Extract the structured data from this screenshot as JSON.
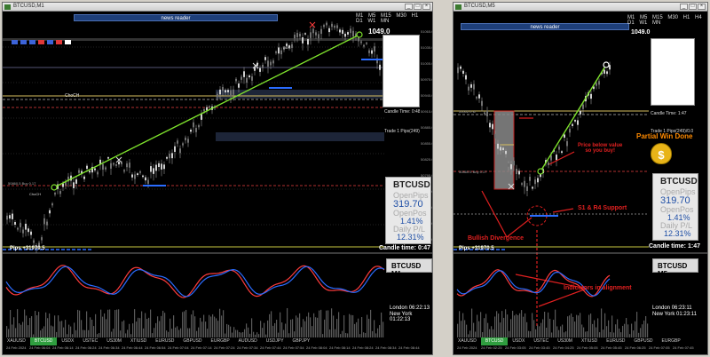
{
  "left": {
    "title": "BTCUSD,M1",
    "newsbar": "news reader",
    "timeframes": "M1 M5 M15 M30 H1 H4 D1 W1 MN",
    "price_tag": "1049.0",
    "symbol": "BTCUSD",
    "open_pips_label": "OpenPips",
    "open_pips_value": "319.70",
    "open_pos_label": "OpenPos",
    "open_pos_value": "1.41%",
    "daily_pl_label": "Daily P/L",
    "daily_pl_value": "12.31%",
    "candle_time_label": "Candle time:",
    "candle_time_value": "0:47",
    "pips_text": "Pips +31970.5",
    "indicator_title": "BTCUSD M1",
    "london_label": "London",
    "london_time": "06:22:13",
    "newyork_label": "New York",
    "newyork_time": "01:22:13",
    "trade_label": "Trade 1 Pips(249)/1.0",
    "candle_time_small": "Candle Time: 0:48",
    "tabs": [
      "XAUUSD",
      "BTCUSD",
      "USDX",
      "USTEC",
      "US30M",
      "XTIUSD",
      "EURUSD",
      "GBPUSD",
      "EURGBP",
      "AUDUSD",
      "USDJPY",
      "GBPJPY"
    ],
    "active_tab": "BTCUSD",
    "dates": [
      "24 Feb 2024",
      "24 Feb 06:04",
      "24 Feb 06:14",
      "24 Feb 06:24",
      "24 Feb 06:34",
      "24 Feb 06:44",
      "24 Feb 06:54",
      "24 Feb 07:04",
      "24 Feb 07:14",
      "24 Feb 07:24",
      "24 Feb 07:34",
      "24 Feb 07:44",
      "24 Feb 07:54",
      "24 Feb 08:04",
      "24 Feb 08:14",
      "24 Feb 08:24",
      "24 Feb 08:34",
      "24 Feb 08:44"
    ],
    "price_axis": [
      "51065.00",
      "51035.00",
      "51005.00",
      "50975.00",
      "50945.00",
      "50915.00",
      "50885.00",
      "50855.00",
      "50825.00",
      "50795.00",
      "50765.00",
      "50735.00",
      "50705.00",
      "50675.00"
    ],
    "chch_label": "ChoCH",
    "bos_label": "BOS",
    "level_label": "50860.5 Buy 0.17"
  },
  "right": {
    "title": "BTCUSD,M5",
    "newsbar": "news reader",
    "timeframes": "M1 M5 M15 M30 H1 H4 D1 W1 MN",
    "price_tag": "1049.0",
    "symbol": "BTCUSD",
    "open_pips_label": "OpenPips",
    "open_pips_value": "319.70",
    "open_pos_label": "OpenPos",
    "open_pos_value": "1.41%",
    "daily_pl_label": "Daily P/L",
    "daily_pl_value": "12.31%",
    "candle_time_label": "Candle time:",
    "candle_time_value": "1:47",
    "pips_text": "Pips +31970.5",
    "indicator_title": "BTCUSD M5",
    "london_label": "London",
    "london_time": "06:23:11",
    "newyork_label": "New York",
    "newyork_time": "01:23:11",
    "trade_label": "Trade 1 Pips(249)/0.0",
    "candle_time_small": "Candle Time: 1:47",
    "tabs": [
      "XAUUSD",
      "BTCUSD",
      "USDX",
      "USTEC",
      "US30M",
      "XTIUSD",
      "EURUSD",
      "GBPUSD",
      "EURGBP",
      "AUDUSD",
      "USDJPY",
      "GBPJPY"
    ],
    "active_tab": "BTCUSD",
    "dates": [
      "24 Feb 2024",
      "24 Feb 02:25",
      "24 Feb 03:05",
      "24 Feb 03:45",
      "24 Feb 04:25",
      "24 Feb 05:05",
      "24 Feb 05:45",
      "24 Feb 06:25",
      "24 Feb 07:05",
      "24 Feb 07:45"
    ],
    "annotations": {
      "partial_wins": "Partial Win Done",
      "price_below": "Price below value\nso you buy!",
      "support": "S1 & R4 Support",
      "bullish_div": "Bullish Divergence",
      "alignment": "Indicators in alignment"
    },
    "level_label": "50860.5 Buy 0.17",
    "level2_label": "51002.0 sl"
  },
  "colors": {
    "trend_line": "#7ee22c",
    "rsi_red": "#ff3b3b",
    "rsi_blue": "#2a6cff",
    "accent_blue": "#1f4fa6",
    "annot_red": "#e02020",
    "annot_orange": "#ff8a00",
    "tab_green": "#2f9e3f"
  }
}
